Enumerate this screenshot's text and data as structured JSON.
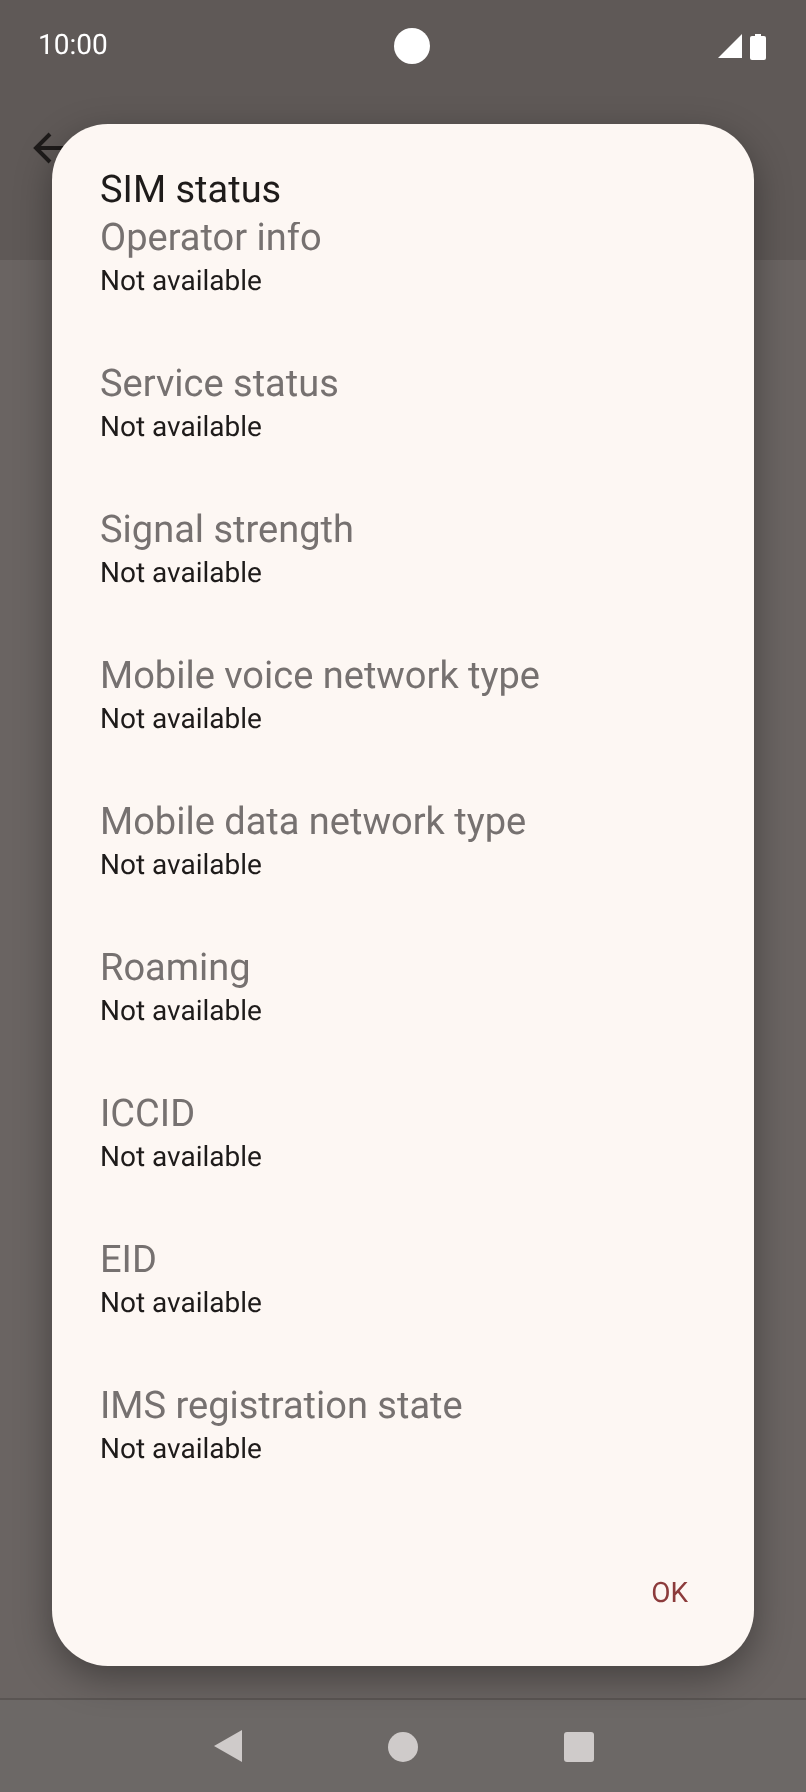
{
  "status_bar": {
    "time": "10:00"
  },
  "dialog": {
    "title": "SIM status",
    "items": [
      {
        "label": "Operator info",
        "value": "Not available"
      },
      {
        "label": "Service status",
        "value": "Not available"
      },
      {
        "label": "Signal strength",
        "value": "Not available"
      },
      {
        "label": "Mobile voice network type",
        "value": "Not available"
      },
      {
        "label": "Mobile data network type",
        "value": "Not available"
      },
      {
        "label": "Roaming",
        "value": "Not available"
      },
      {
        "label": "ICCID",
        "value": "Not available"
      },
      {
        "label": "EID",
        "value": "Not available"
      },
      {
        "label": "IMS registration state",
        "value": "Not available"
      }
    ],
    "button": "OK"
  }
}
